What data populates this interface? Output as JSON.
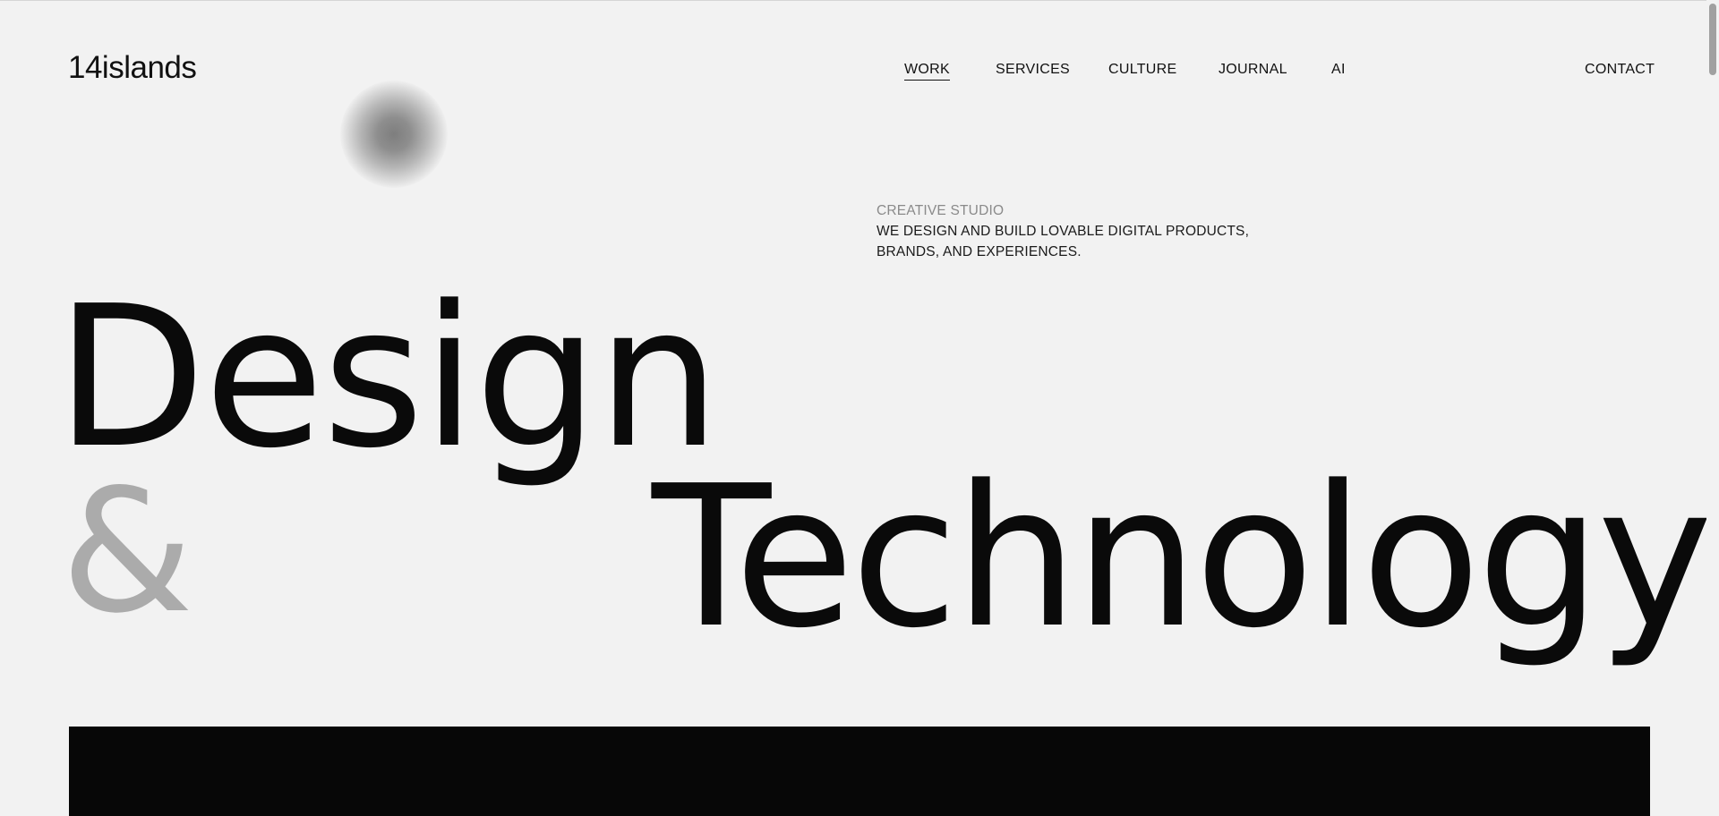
{
  "brand": {
    "logo_text": "14islands"
  },
  "nav": {
    "items": [
      {
        "label": "WORK",
        "active": true
      },
      {
        "label": "SERVICES",
        "active": false
      },
      {
        "label": "CULTURE",
        "active": false
      },
      {
        "label": "JOURNAL",
        "active": false
      },
      {
        "label": "AI",
        "active": false
      }
    ],
    "contact_label": "CONTACT"
  },
  "intro": {
    "label": "CREATIVE STUDIO",
    "text": "WE DESIGN AND BUILD LOVABLE DIGITAL PRODUCTS, BRANDS, AND EXPERIENCES."
  },
  "hero": {
    "word1": "Design",
    "ampersand": "&",
    "word2": "Technology"
  },
  "colors": {
    "background": "#f2f2f2",
    "text": "#0a0a0a",
    "ampersand": "#ababab",
    "label": "#8a8a8a",
    "panel": "#070707"
  }
}
